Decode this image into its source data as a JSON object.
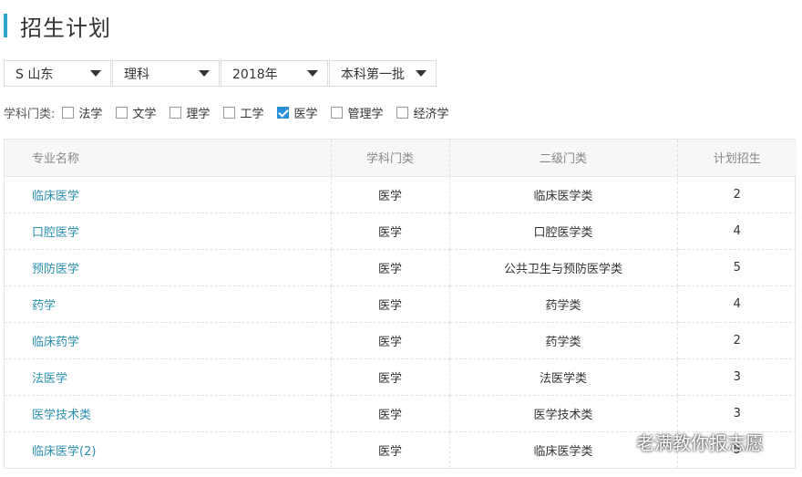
{
  "header": {
    "title": "招生计划"
  },
  "filters": {
    "province": "S 山东",
    "subject": "理科",
    "year": "2018年",
    "batch": "本科第一批"
  },
  "categories": {
    "label": "学科门类:",
    "items": [
      {
        "label": "法学",
        "checked": false
      },
      {
        "label": "文学",
        "checked": false
      },
      {
        "label": "理学",
        "checked": false
      },
      {
        "label": "工学",
        "checked": false
      },
      {
        "label": "医学",
        "checked": true
      },
      {
        "label": "管理学",
        "checked": false
      },
      {
        "label": "经济学",
        "checked": false
      }
    ]
  },
  "table": {
    "headers": [
      "专业名称",
      "学科门类",
      "二级门类",
      "计划招生"
    ],
    "rows": [
      [
        "临床医学",
        "医学",
        "临床医学类",
        "2"
      ],
      [
        "口腔医学",
        "医学",
        "口腔医学类",
        "4"
      ],
      [
        "预防医学",
        "医学",
        "公共卫生与预防医学类",
        "5"
      ],
      [
        "药学",
        "医学",
        "药学类",
        "4"
      ],
      [
        "临床药学",
        "医学",
        "药学类",
        "2"
      ],
      [
        "法医学",
        "医学",
        "法医学类",
        "3"
      ],
      [
        "医学技术类",
        "医学",
        "医学技术类",
        "3"
      ],
      [
        "临床医学(2)",
        "医学",
        "临床医学类",
        "5"
      ]
    ]
  },
  "watermark": {
    "text": "老满教你报志愿"
  },
  "colors": {
    "accent": "#2aa3c9",
    "link": "#2a8fb0",
    "checkbox": "#2a8fd6"
  }
}
